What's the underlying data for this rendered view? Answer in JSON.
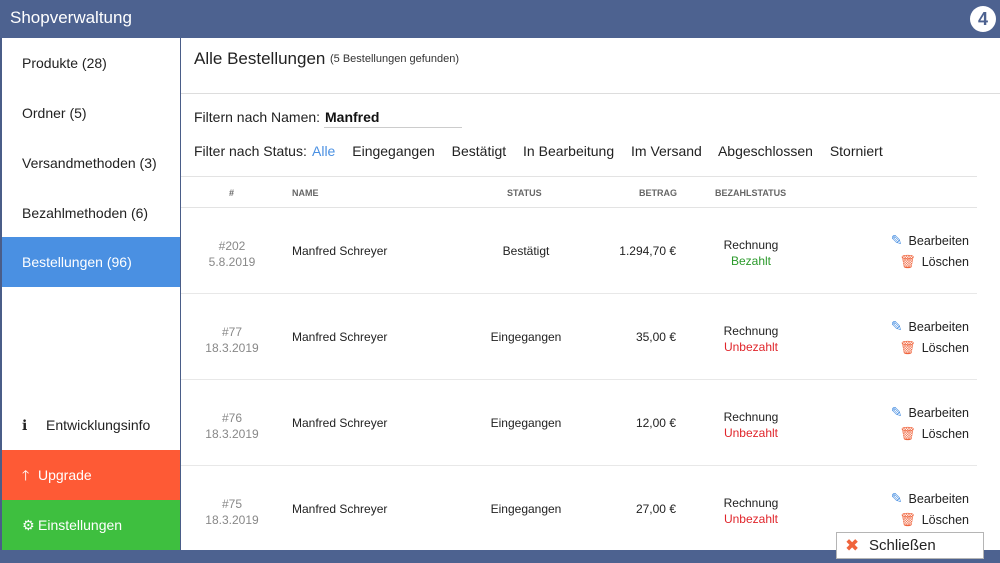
{
  "app": {
    "title": "Shopverwaltung",
    "logo_text": "4"
  },
  "sidebar": {
    "items": [
      {
        "label": "Produkte (28)"
      },
      {
        "label": "Ordner (5)"
      },
      {
        "label": "Versandmethoden (3)"
      },
      {
        "label": "Bezahlmethoden (6)"
      },
      {
        "label": "Bestellungen (96)"
      }
    ],
    "info_label": "Entwicklungsinfo",
    "upgrade_label": "Upgrade",
    "settings_label": "Einstellungen"
  },
  "main": {
    "title": "Alle Bestellungen",
    "count": "(5 Bestellungen gefunden)",
    "filter_name_label": "Filtern nach Namen:",
    "filter_name_value": "Manfred",
    "filter_status_label": "Filter nach Status:",
    "status_filters": [
      "Alle",
      "Eingegangen",
      "Bestätigt",
      "In Bearbeitung",
      "Im Versand",
      "Abgeschlossen",
      "Storniert"
    ],
    "columns": {
      "num": "#",
      "name": "NAME",
      "status": "STATUS",
      "amount": "BETRAG",
      "pay": "BEZAHLSTATUS"
    },
    "orders": [
      {
        "num": "#202",
        "date": "5.8.2019",
        "name": "Manfred Schreyer",
        "status": "Bestätigt",
        "amount": "1.294,70 €",
        "method": "Rechnung",
        "paid": "Bezahlt"
      },
      {
        "num": "#77",
        "date": "18.3.2019",
        "name": "Manfred Schreyer",
        "status": "Eingegangen",
        "amount": "35,00 €",
        "method": "Rechnung",
        "paid": "Unbezahlt"
      },
      {
        "num": "#76",
        "date": "18.3.2019",
        "name": "Manfred Schreyer",
        "status": "Eingegangen",
        "amount": "12,00 €",
        "method": "Rechnung",
        "paid": "Unbezahlt"
      },
      {
        "num": "#75",
        "date": "18.3.2019",
        "name": "Manfred Schreyer",
        "status": "Eingegangen",
        "amount": "27,00 €",
        "method": "Rechnung",
        "paid": "Unbezahlt"
      }
    ],
    "edit_label": "Bearbeiten",
    "delete_label": "Löschen"
  },
  "close_label": "Schließen",
  "colors": {
    "header": "#4d6290",
    "accent": "#4a90e2",
    "upgrade": "#fe5a35",
    "settings": "#3ebf3f",
    "paid": "#2b9a2b",
    "unpaid": "#e0252b"
  },
  "icons": {
    "info": "info-icon",
    "upgrade": "arrow-up-icon",
    "settings": "gear-icon",
    "edit": "pencil-icon",
    "delete": "trash-icon",
    "close": "close-icon"
  }
}
